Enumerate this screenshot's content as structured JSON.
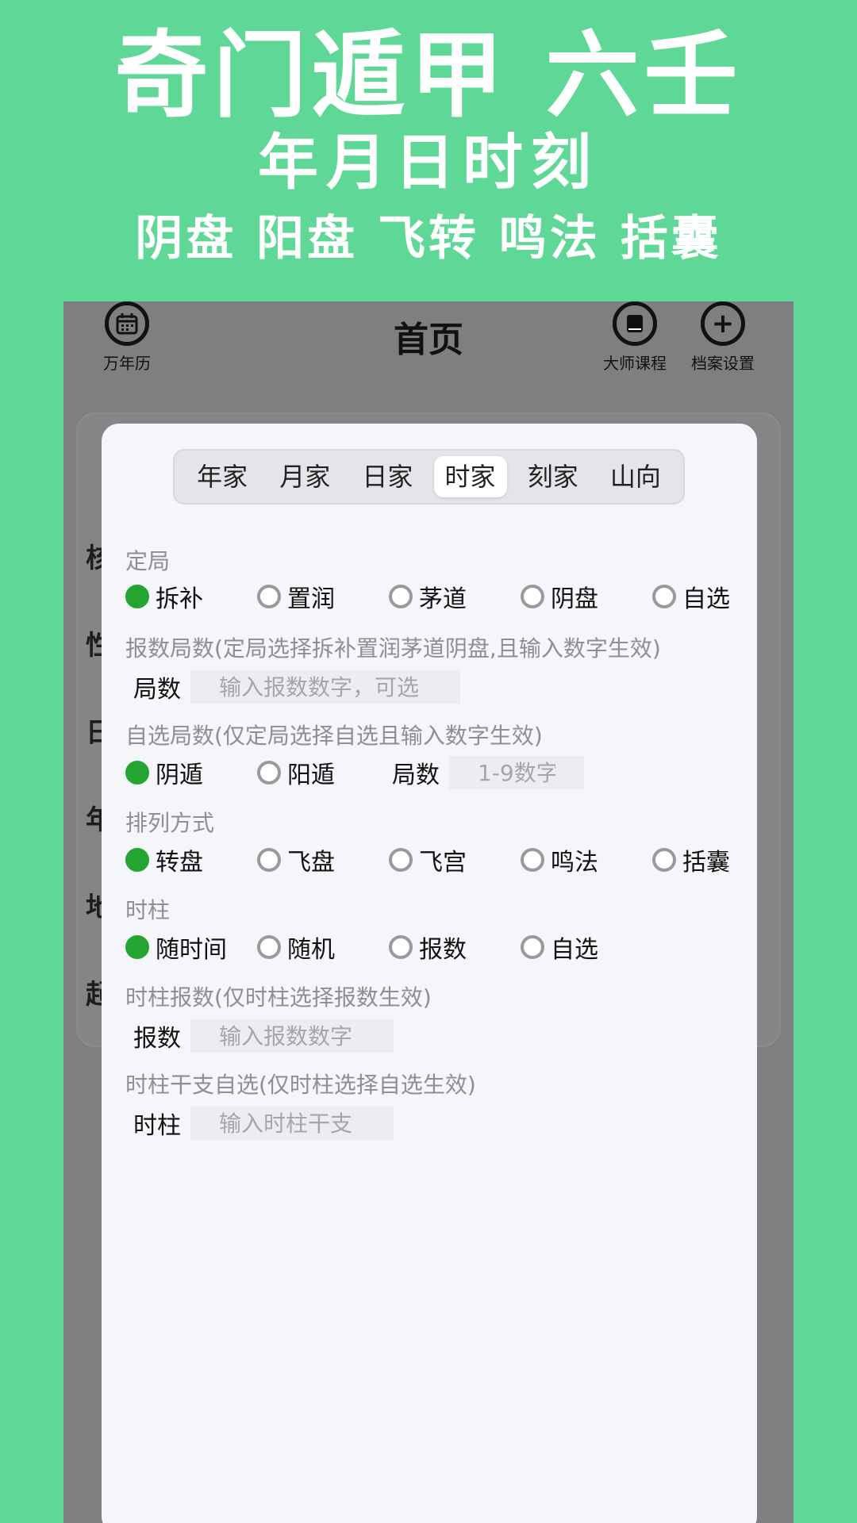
{
  "promo": {
    "line1": "奇门遁甲  六壬",
    "line2": "年月日时刻",
    "line3": "阴盘 阳盘 飞转 鸣法 括囊"
  },
  "nav": {
    "title": "首页",
    "left": {
      "label": "万年历",
      "icon": "calendar-icon"
    },
    "right1": {
      "label": "大师课程",
      "icon": "book-icon"
    },
    "right2": {
      "label": "档案设置",
      "icon": "plus-icon"
    }
  },
  "background_row_chars": [
    "核",
    "性",
    "日",
    "年",
    "地",
    "起"
  ],
  "tabs": [
    "年家",
    "月家",
    "日家",
    "时家",
    "刻家",
    "山向"
  ],
  "active_tab": "时家",
  "sections": {
    "dingju": {
      "label": "定局",
      "options": [
        "拆补",
        "置润",
        "茅道",
        "阴盘",
        "自选"
      ],
      "selected": "拆补"
    },
    "baoshu_jushu": {
      "label": "报数局数(定局选择拆补置润茅道阴盘,且输入数字生效)",
      "field_label": "局数",
      "placeholder": "输入报数数字，可选"
    },
    "zixuan_jushu": {
      "label": "自选局数(仅定局选择自选且输入数字生效)",
      "options": [
        "阴遁",
        "阳遁"
      ],
      "selected": "阴遁",
      "field_label": "局数",
      "placeholder": "1-9数字"
    },
    "pailie": {
      "label": "排列方式",
      "options": [
        "转盘",
        "飞盘",
        "飞宫",
        "鸣法",
        "括囊"
      ],
      "selected": "转盘"
    },
    "shizhu": {
      "label": "时柱",
      "options": [
        "随时间",
        "随机",
        "报数",
        "自选"
      ],
      "selected": "随时间"
    },
    "shizhu_baoshu": {
      "label": "时柱报数(仅时柱选择报数生效)",
      "field_label": "报数",
      "placeholder": "输入报数数字"
    },
    "shizhu_ganzhi": {
      "label": "时柱干支自选(仅时柱选择自选生效)",
      "field_label": "时柱",
      "placeholder": "输入时柱干支"
    }
  },
  "colors": {
    "background": "#5fd897",
    "radio_selected": "#24a531",
    "overlay": "#7d7f80"
  }
}
